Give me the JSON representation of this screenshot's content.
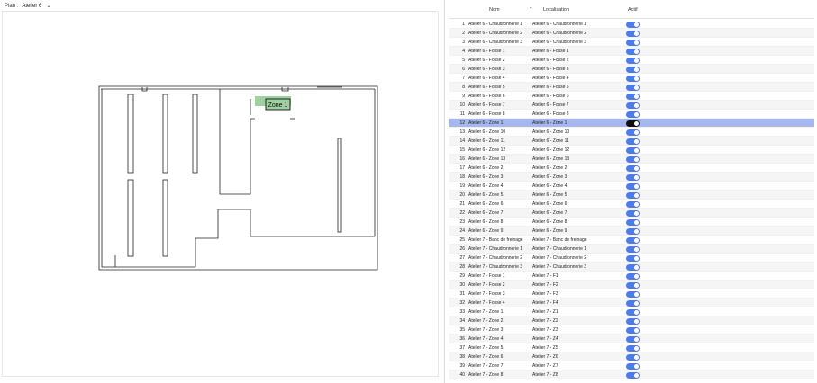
{
  "plan": {
    "label": "Plan :",
    "selected": "Atelier 6",
    "highlight_label": "Zone 1"
  },
  "table": {
    "headers": {
      "nom": "Nom",
      "localisation": "Localisation",
      "actif": "Actif"
    },
    "rows": [
      {
        "n": "1",
        "nom": "Atelier 6 - Chaudronnerie 1",
        "loc": "Atelier 6 - Chaudronnerie 1",
        "actif": true
      },
      {
        "n": "2",
        "nom": "Atelier 6 - Chaudronnerie 2",
        "loc": "Atelier 6 - Chaudronnerie 2",
        "actif": true
      },
      {
        "n": "3",
        "nom": "Atelier 6 - Chaudronnerie 3",
        "loc": "Atelier 6 - Chaudronnerie 3",
        "actif": true
      },
      {
        "n": "4",
        "nom": "Atelier 6 - Fosse 1",
        "loc": "Atelier 6 - Fosse 1",
        "actif": true
      },
      {
        "n": "5",
        "nom": "Atelier 6 - Fosse 2",
        "loc": "Atelier 6 - Fosse 2",
        "actif": true
      },
      {
        "n": "6",
        "nom": "Atelier 6 - Fosse 3",
        "loc": "Atelier 6 - Fosse 3",
        "actif": true
      },
      {
        "n": "7",
        "nom": "Atelier 6 - Fosse 4",
        "loc": "Atelier 6 - Fosse 4",
        "actif": true
      },
      {
        "n": "8",
        "nom": "Atelier 6 - Fosse 5",
        "loc": "Atelier 6 - Fosse 5",
        "actif": true
      },
      {
        "n": "9",
        "nom": "Atelier 6 - Fosse 6",
        "loc": "Atelier 6 - Fosse 6",
        "actif": true
      },
      {
        "n": "10",
        "nom": "Atelier 6 - Fosse 7",
        "loc": "Atelier 6 - Fosse 7",
        "actif": true
      },
      {
        "n": "11",
        "nom": "Atelier 6 - Fosse 8",
        "loc": "Atelier 6 - Fosse 8",
        "actif": true
      },
      {
        "n": "12",
        "nom": "Atelier 6 - Zone 1",
        "loc": "Atelier 6 - Zone 1",
        "actif": true,
        "selected": true
      },
      {
        "n": "13",
        "nom": "Atelier 6 - Zone 10",
        "loc": "Atelier 6 - Zone 10",
        "actif": true
      },
      {
        "n": "14",
        "nom": "Atelier 6 - Zone 11",
        "loc": "Atelier 6 - Zone 11",
        "actif": true
      },
      {
        "n": "15",
        "nom": "Atelier 6 - Zone 12",
        "loc": "Atelier 6 - Zone 12",
        "actif": true
      },
      {
        "n": "16",
        "nom": "Atelier 6 - Zone 13",
        "loc": "Atelier 6 - Zone 13",
        "actif": true
      },
      {
        "n": "17",
        "nom": "Atelier 6 - Zone 2",
        "loc": "Atelier 6 - Zone 2",
        "actif": true
      },
      {
        "n": "18",
        "nom": "Atelier 6 - Zone 3",
        "loc": "Atelier 6 - Zone 3",
        "actif": true
      },
      {
        "n": "19",
        "nom": "Atelier 6 - Zone 4",
        "loc": "Atelier 6 - Zone 4",
        "actif": true
      },
      {
        "n": "20",
        "nom": "Atelier 6 - Zone 5",
        "loc": "Atelier 6 - Zone 5",
        "actif": true
      },
      {
        "n": "21",
        "nom": "Atelier 6 - Zone 6",
        "loc": "Atelier 6 - Zone 6",
        "actif": true
      },
      {
        "n": "22",
        "nom": "Atelier 6 - Zone 7",
        "loc": "Atelier 6 - Zone 7",
        "actif": true
      },
      {
        "n": "23",
        "nom": "Atelier 6 - Zone 8",
        "loc": "Atelier 6 - Zone 8",
        "actif": true
      },
      {
        "n": "24",
        "nom": "Atelier 6 - Zone 9",
        "loc": "Atelier 6 - Zone 9",
        "actif": true
      },
      {
        "n": "25",
        "nom": "Atelier 7 - Banc de freinage",
        "loc": "Atelier 7 - Banc de freinage",
        "actif": true
      },
      {
        "n": "26",
        "nom": "Atelier 7 - Chaudronnerie 1",
        "loc": "Atelier 7 - Chaudronnerie 1",
        "actif": true
      },
      {
        "n": "27",
        "nom": "Atelier 7 - Chaudronnerie 2",
        "loc": "Atelier 7 - Chaudronnerie 2",
        "actif": true
      },
      {
        "n": "28",
        "nom": "Atelier 7 - Chaudronnerie 3",
        "loc": "Atelier 7 - Chaudronnerie 3",
        "actif": true
      },
      {
        "n": "29",
        "nom": "Atelier 7 - Fosse 1",
        "loc": "Atelier 7 - F1",
        "actif": true
      },
      {
        "n": "30",
        "nom": "Atelier 7 - Fosse 2",
        "loc": "Atelier 7 - F2",
        "actif": true
      },
      {
        "n": "31",
        "nom": "Atelier 7 - Fosse 3",
        "loc": "Atelier 7 - F3",
        "actif": true
      },
      {
        "n": "32",
        "nom": "Atelier 7 - Fosse 4",
        "loc": "Atelier 7 - F4",
        "actif": true
      },
      {
        "n": "33",
        "nom": "Atelier 7 - Zone 1",
        "loc": "Atelier 7 - Z1",
        "actif": true
      },
      {
        "n": "34",
        "nom": "Atelier 7 - Zone 2",
        "loc": "Atelier 7 - Z2",
        "actif": true
      },
      {
        "n": "35",
        "nom": "Atelier 7 - Zone 3",
        "loc": "Atelier 7 - Z3",
        "actif": true
      },
      {
        "n": "36",
        "nom": "Atelier 7 - Zone 4",
        "loc": "Atelier 7 - Z4",
        "actif": true
      },
      {
        "n": "37",
        "nom": "Atelier 7 - Zone 5",
        "loc": "Atelier 7 - Z5",
        "actif": true
      },
      {
        "n": "38",
        "nom": "Atelier 7 - Zone 6",
        "loc": "Atelier 7 - Z6",
        "actif": true
      },
      {
        "n": "39",
        "nom": "Atelier 7 - Zone 7",
        "loc": "Atelier 7 - Z7",
        "actif": true
      },
      {
        "n": "40",
        "nom": "Atelier 7 - Zone 8",
        "loc": "Atelier 7 - Z8",
        "actif": true
      }
    ]
  },
  "colors": {
    "selected_row": "#a6b6ee",
    "toggle_on": "#4f7be7",
    "toggle_selected": "#111111",
    "zone_highlight": "#9fd09f"
  },
  "icons": {
    "sort": "caret-up-icon",
    "dropdown": "chevron-down-icon"
  }
}
